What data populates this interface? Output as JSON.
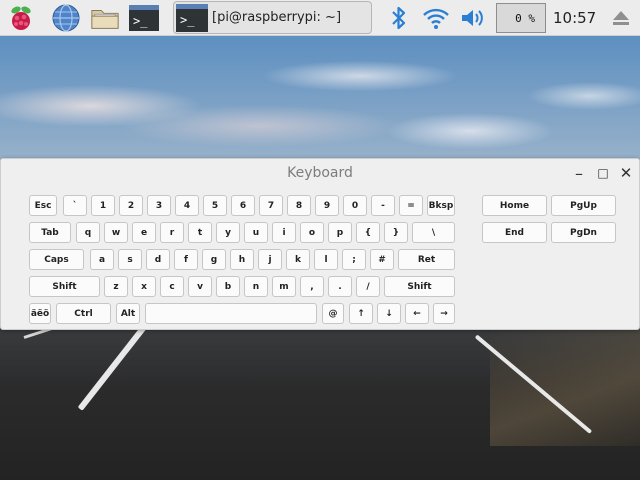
{
  "taskbar": {
    "task_label": "[pi@raspberrypi: ~]",
    "terminal_glyph": ">_",
    "cpu": "0 %",
    "clock": "10:57"
  },
  "window": {
    "title": "Keyboard",
    "minimize_glyph": "–",
    "maximize_glyph": "□",
    "close_glyph": "✕"
  },
  "keys": {
    "esc": "Esc",
    "grave": "`",
    "k1": "1",
    "k2": "2",
    "k3": "3",
    "k4": "4",
    "k5": "5",
    "k6": "6",
    "k7": "7",
    "k8": "8",
    "k9": "9",
    "k0": "0",
    "minus": "-",
    "equals": "=",
    "bksp": "Bksp",
    "tab": "Tab",
    "q": "q",
    "w": "w",
    "e": "e",
    "r": "r",
    "t": "t",
    "y": "y",
    "u": "u",
    "i": "i",
    "o": "o",
    "p": "p",
    "lbrace": "{",
    "rbrace": "}",
    "backslash": "\\",
    "caps": "Caps",
    "a": "a",
    "s": "s",
    "d": "d",
    "f": "f",
    "g": "g",
    "h": "h",
    "j": "j",
    "k": "k",
    "l": "l",
    "semicolon": ";",
    "hash": "#",
    "ret": "Ret",
    "shift_l": "Shift",
    "z": "z",
    "x": "x",
    "c": "c",
    "v": "v",
    "b": "b",
    "n": "n",
    "m": "m",
    "comma": ",",
    "period": ".",
    "slash": "/",
    "shift_r": "Shift",
    "intl": "äëö",
    "ctrl": "Ctrl",
    "alt": "Alt",
    "space": "",
    "at": "@",
    "up": "↑",
    "down": "↓",
    "left": "←",
    "right": "→",
    "home": "Home",
    "pgup": "PgUp",
    "end": "End",
    "pgdn": "PgDn"
  },
  "colors": {
    "panel_bg": "#ececec",
    "window_bg": "#efefef",
    "key_bg": "#fbfbfb",
    "accent_blue": "#2a7fd4",
    "rpi_red": "#c51a4a"
  }
}
